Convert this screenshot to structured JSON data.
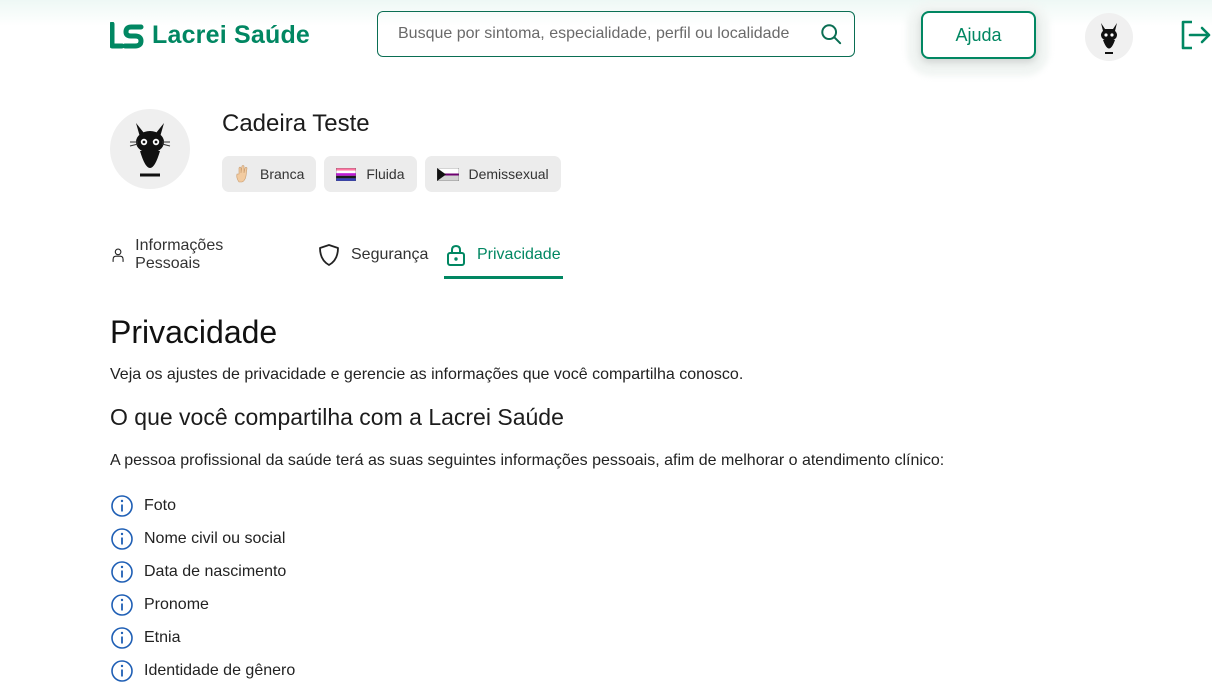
{
  "header": {
    "logo_text": "Lacrei Saúde",
    "search_placeholder": "Busque por sintoma, especialidade, perfil ou localidade",
    "help_label": "Ajuda",
    "brand_color": "#018762",
    "icons": [
      "logo-icon",
      "search-icon",
      "avatar",
      "logout-icon"
    ]
  },
  "profile": {
    "name": "Cadeira Teste",
    "tags": [
      {
        "label": "Branca",
        "icon": "hand-icon"
      },
      {
        "label": "Fluida",
        "icon": "genderfluid-flag-icon"
      },
      {
        "label": "Demissexual",
        "icon": "demisexual-flag-icon"
      }
    ]
  },
  "tabs": [
    {
      "label": "Informações Pessoais",
      "icon": "user-icon",
      "active": false
    },
    {
      "label": "Segurança",
      "icon": "shield-icon",
      "active": false
    },
    {
      "label": "Privacidade",
      "icon": "lock-icon",
      "active": true
    }
  ],
  "content": {
    "title": "Privacidade",
    "description": "Veja os ajustes de privacidade e gerencie as informações que você compartilha conosco.",
    "section_title": "O que você compartilha com a Lacrei Saúde",
    "section_description": "A pessoa profissional da saúde terá as suas seguintes informações pessoais, afim de melhorar o atendimento clínico:",
    "items": [
      "Foto",
      "Nome civil ou social",
      "Data de nascimento",
      "Pronome",
      "Etnia",
      "Identidade de gênero"
    ],
    "info_icon_color": "#1f5fb5"
  }
}
